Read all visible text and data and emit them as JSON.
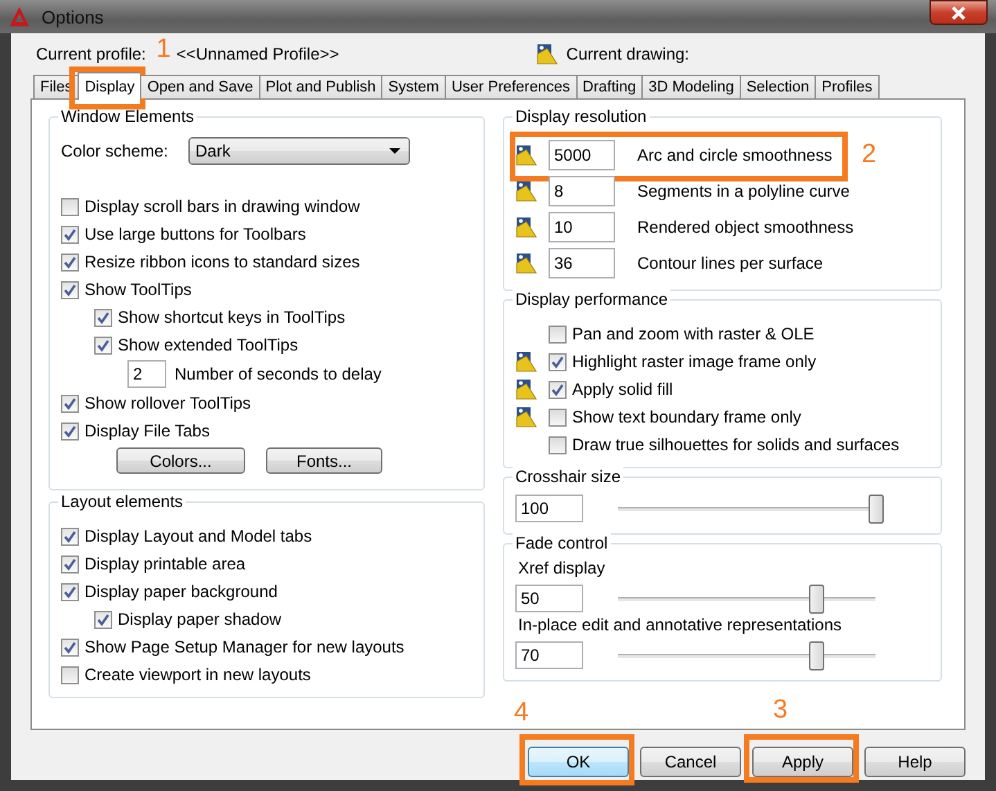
{
  "window": {
    "title": "Options"
  },
  "profile": {
    "label": "Current profile:",
    "value": "<<Unnamed Profile>>",
    "drawing_label": "Current drawing:"
  },
  "tabs": [
    {
      "label": "Files",
      "selected": false
    },
    {
      "label": "Display",
      "selected": true,
      "annotation": "1"
    },
    {
      "label": "Open and Save",
      "selected": false
    },
    {
      "label": "Plot and Publish",
      "selected": false
    },
    {
      "label": "System",
      "selected": false
    },
    {
      "label": "User Preferences",
      "selected": false
    },
    {
      "label": "Drafting",
      "selected": false
    },
    {
      "label": "3D Modeling",
      "selected": false
    },
    {
      "label": "Selection",
      "selected": false
    },
    {
      "label": "Profiles",
      "selected": false
    }
  ],
  "window_elements": {
    "title": "Window Elements",
    "color_scheme": {
      "label": "Color scheme:",
      "value": "Dark"
    },
    "options": [
      {
        "kind": "checkbox",
        "label": "Display scroll bars in drawing window",
        "checked": false
      },
      {
        "kind": "checkbox",
        "label": "Use large buttons for Toolbars",
        "checked": true
      },
      {
        "kind": "checkbox",
        "label": "Resize ribbon icons to standard sizes",
        "checked": true
      },
      {
        "kind": "checkbox",
        "label": "Show ToolTips",
        "checked": true,
        "children": [
          {
            "kind": "checkbox",
            "label": "Show shortcut keys in ToolTips",
            "checked": true
          },
          {
            "kind": "checkbox",
            "label": "Show extended ToolTips",
            "checked": true,
            "children": [
              {
                "kind": "number",
                "value": "2",
                "label": "Number of seconds to delay"
              }
            ]
          }
        ]
      },
      {
        "kind": "checkbox",
        "label": "Show rollover ToolTips",
        "checked": true
      },
      {
        "kind": "checkbox",
        "label": "Display File Tabs",
        "checked": true
      }
    ],
    "buttons": [
      "Colors...",
      "Fonts..."
    ]
  },
  "layout_elements": {
    "title": "Layout elements",
    "options": [
      {
        "kind": "checkbox",
        "label": "Display Layout and Model tabs",
        "checked": true
      },
      {
        "kind": "checkbox",
        "label": "Display printable area",
        "checked": true
      },
      {
        "kind": "checkbox",
        "label": "Display paper background",
        "checked": true,
        "children": [
          {
            "kind": "checkbox",
            "label": "Display paper shadow",
            "checked": true
          }
        ]
      },
      {
        "kind": "checkbox",
        "label": "Show Page Setup Manager for new layouts",
        "checked": true
      },
      {
        "kind": "checkbox",
        "label": "Create viewport in new layouts",
        "checked": false
      }
    ]
  },
  "display_resolution": {
    "title": "Display resolution",
    "rows": [
      {
        "value": "5000",
        "label": "Arc and circle smoothness",
        "annotation": "2"
      },
      {
        "value": "8",
        "label": "Segments in a polyline curve"
      },
      {
        "value": "10",
        "label": "Rendered object smoothness"
      },
      {
        "value": "36",
        "label": "Contour lines per surface"
      }
    ]
  },
  "display_performance": {
    "title": "Display performance",
    "options": [
      {
        "label": "Pan and zoom with raster & OLE",
        "checked": false,
        "drawing_icon": false
      },
      {
        "label": "Highlight raster image frame only",
        "checked": true,
        "drawing_icon": true
      },
      {
        "label": "Apply solid fill",
        "checked": true,
        "drawing_icon": true
      },
      {
        "label": "Show text boundary frame only",
        "checked": false,
        "drawing_icon": true
      },
      {
        "label": "Draw true silhouettes for solids and surfaces",
        "checked": false,
        "drawing_icon": false
      }
    ]
  },
  "crosshair_size": {
    "title": "Crosshair size",
    "value": "100",
    "level": 1
  },
  "fade_control": {
    "title": "Fade control",
    "sliders": [
      {
        "label": "Xref display",
        "value": "50",
        "level": 0.77
      },
      {
        "label": "In-place edit and annotative representations",
        "value": "70",
        "level": 0.77
      }
    ]
  },
  "buttons": [
    {
      "label": "OK",
      "default": true,
      "annotation": "4"
    },
    {
      "label": "Cancel",
      "default": false
    },
    {
      "label": "Apply",
      "default": false,
      "annotation": "3"
    },
    {
      "label": "Help",
      "default": false
    }
  ]
}
